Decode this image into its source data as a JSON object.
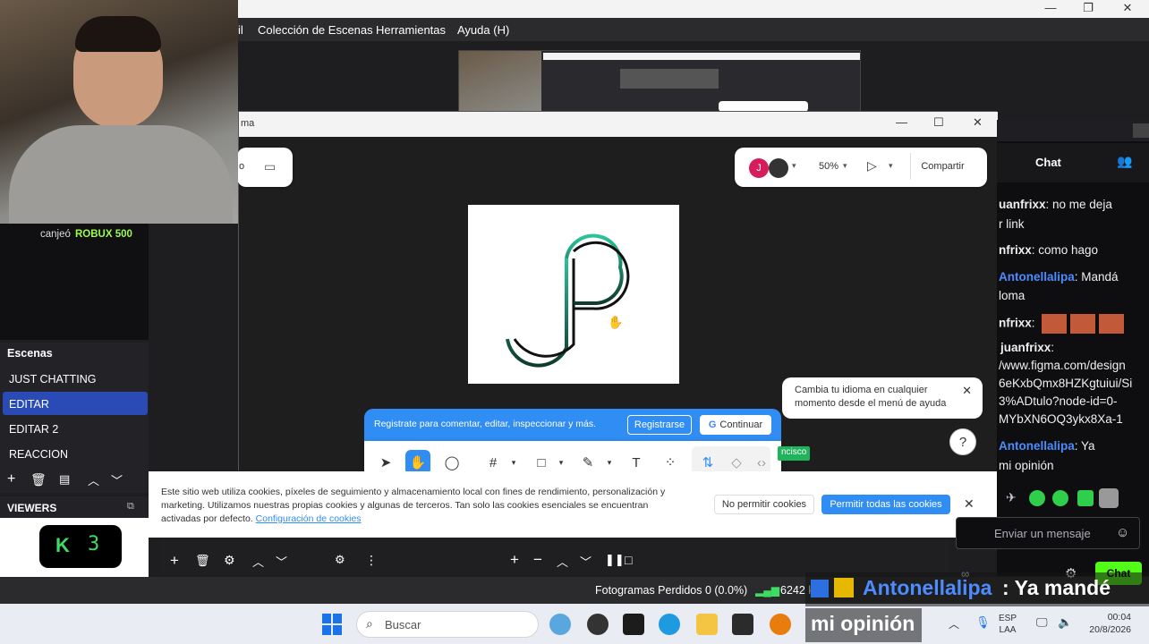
{
  "obs": {
    "menu": [
      "il",
      "Colección de Escenas",
      "Herramientas",
      "Ayuda (H)"
    ],
    "window_controls": [
      "—",
      "❐",
      "✕"
    ],
    "scenes_title": "Escenas",
    "scenes": [
      "JUST CHATTING",
      "EDITAR",
      "EDITAR 2",
      "REACCION"
    ],
    "active_scene_index": 1,
    "viewers_title": "VIEWERS",
    "viewers_count": "3",
    "alert_text_user": "canjeó",
    "alert_text_reward": "ROBUX 500",
    "status_frames": "Fotogramas Perdidos 0 (0.0%)",
    "status_bitrate": "6242 k"
  },
  "figma": {
    "window_title": "ma",
    "window_controls": [
      "—",
      "☐",
      "✕"
    ],
    "left_pill_text": "o",
    "avatar_initial": "J",
    "zoom": "50%",
    "share_label": "Compartir",
    "signup_text": "Registrate para comentar, editar, inspeccionar y más.",
    "register_label": "Registrarse",
    "continue_label": "Continuar",
    "tooltip_text": "Cambia tu idioma en cualquier momento desde el menú de ayuda",
    "help_label": "?",
    "collaborator_tag": "ncisco"
  },
  "cookies": {
    "line1": "Este sitio web utiliza cookies, píxeles de seguimiento y almacenamiento local con fines de rendimiento, personalización y",
    "line2": "marketing. Utilizamos nuestras propias cookies y algunas de terceros. Tan solo las cookies esenciales se encuentran",
    "line3": "activadas por defecto.",
    "config_link": "Configuración de cookies",
    "deny_label": "No permitir cookies",
    "allow_label": "Permitir todas las cookies"
  },
  "chat": {
    "title": "Chat",
    "messages": [
      {
        "name": "uanfrixx",
        "text": ": no me deja",
        "color": "#efeff1"
      },
      {
        "name": "",
        "text": "r link",
        "color": "#efeff1"
      },
      {
        "name": "nfrixx",
        "text": ": como hago",
        "color": "#efeff1"
      },
      {
        "name": "Antonellalipa",
        "text": ": Mandá",
        "color": "#4c8cff"
      },
      {
        "name": "",
        "text": "loma",
        "color": "#efeff1"
      },
      {
        "name": "nfrixx",
        "text": ":",
        "color": "#efeff1"
      },
      {
        "name": "juanfrixx",
        "text": ":",
        "color": "#efeff1"
      },
      {
        "name": "",
        "text": "/www.figma.com/design",
        "color": "#efeff1"
      },
      {
        "name": "",
        "text": "6eKxbQmx8HZKgtuiui/Si",
        "color": "#efeff1"
      },
      {
        "name": "",
        "text": "3%ADtulo?node-id=0-",
        "color": "#efeff1"
      },
      {
        "name": "",
        "text": "MYbXN6OQ3ykx8Xa-1",
        "color": "#efeff1"
      },
      {
        "name": "Antonellalipa",
        "text": ": Ya",
        "color": "#4c8cff"
      },
      {
        "name": "",
        "text": "mi opinión",
        "color": "#efeff1"
      }
    ],
    "input_placeholder": "Enviar un mensaje",
    "send_label": "Chat"
  },
  "overlay": {
    "name": "Antonellalipa",
    "message_line1": ": Ya mandé",
    "message_line2": "mi opinión"
  },
  "taskbar": {
    "search_placeholder": "Buscar",
    "lang_line1": "ESP",
    "lang_line2": "LAA",
    "time": "00:04",
    "date": "20/8/2026"
  },
  "colors": {
    "obs_dark": "#1e1e21",
    "scene_active": "#2a4ab5",
    "figma_blue": "#2f8df4",
    "chat_name_blue": "#4c8cff",
    "viewer_green": "#3ddc63"
  }
}
